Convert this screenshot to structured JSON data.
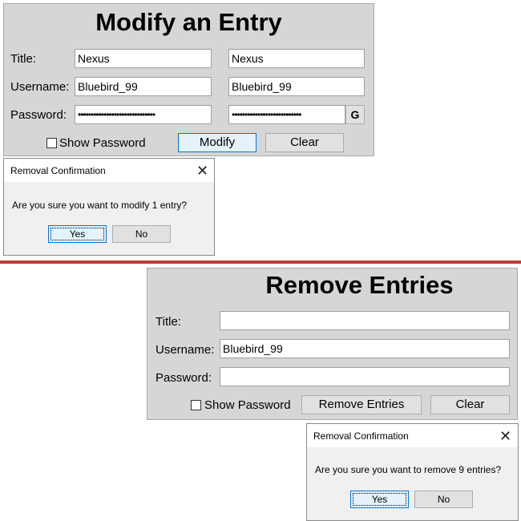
{
  "modify": {
    "title": "Modify an Entry",
    "labels": {
      "title": "Title:",
      "username": "Username:",
      "password": "Password:"
    },
    "old_values": {
      "title": "Nexus",
      "username": "Bluebird_99",
      "password": "••••••••••••••••••••••••••••••"
    },
    "new_values": {
      "title": "Nexus",
      "username": "Bluebird_99",
      "password": "•••••••••••••••••••••••••••"
    },
    "generate_label": "G",
    "show_password_label": "Show Password",
    "modify_button": "Modify",
    "clear_button": "Clear"
  },
  "modify_dialog": {
    "title": "Removal Confirmation",
    "message": "Are you sure you want to modify 1 entry?",
    "yes": "Yes",
    "no": "No",
    "close": "✕"
  },
  "remove": {
    "title": "Remove Entries",
    "labels": {
      "title": "Title:",
      "username": "Username:",
      "password": "Password:"
    },
    "values": {
      "title": "",
      "username": "Bluebird_99",
      "password": ""
    },
    "show_password_label": "Show Password",
    "remove_button": "Remove Entries",
    "clear_button": "Clear"
  },
  "remove_dialog": {
    "title": "Removal Confirmation",
    "message": "Are you sure you want to remove 9 entries?",
    "yes": "Yes",
    "no": "No",
    "close": "✕"
  },
  "colors": {
    "divider": "#c0393b",
    "focus": "#0078d7",
    "panel": "#d6d6d6"
  }
}
